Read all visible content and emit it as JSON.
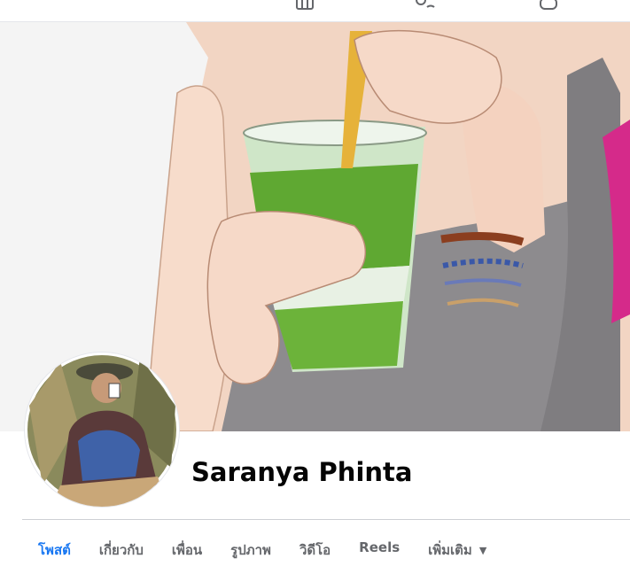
{
  "topbar": {
    "icons": [
      "marketplace-icon",
      "groups-icon",
      "gaming-icon"
    ]
  },
  "cover": {
    "description_icon": "watercolor-cover-photo"
  },
  "profile": {
    "name": "Saranya Phinta"
  },
  "tabs": [
    {
      "label": "โพสต์",
      "active": true
    },
    {
      "label": "เกี่ยวกับ",
      "active": false
    },
    {
      "label": "เพื่อน",
      "active": false
    },
    {
      "label": "รูปภาพ",
      "active": false
    },
    {
      "label": "วิดีโอ",
      "active": false
    },
    {
      "label": "Reels",
      "active": false
    },
    {
      "label": "เพิ่มเติม",
      "active": false
    }
  ],
  "colors": {
    "accent": "#1877f2",
    "tab_text": "#65676b",
    "name_text": "#050505"
  }
}
